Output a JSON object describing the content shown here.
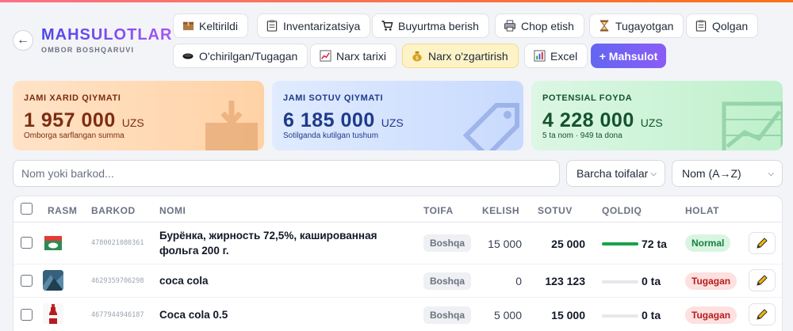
{
  "header": {
    "back_icon": "arrow-left-icon",
    "title": "MAHSULOTLAR",
    "subtitle": "OMBOR BOSHQARUVI"
  },
  "toolbar": {
    "keltirildi": "Keltirildi",
    "inventarizatsiya": "Inventarizatsiya",
    "buyurtma": "Buyurtma berish",
    "chop": "Chop etish",
    "tugayotgan": "Tugayotgan",
    "qolgan": "Qolgan",
    "ochirilgan": "O'chirilgan/Tugagan",
    "narx_tarixi": "Narx tarixi",
    "narx_ozgartirish": "Narx o'zgartirish",
    "excel": "Excel",
    "add": "+ Mahsulot"
  },
  "stats": {
    "purchase": {
      "label": "JAMI XARID QIYMATI",
      "value": "1 957 000",
      "unit": "UZS",
      "note": "Omborga sarflangan summa"
    },
    "sales": {
      "label": "JAMI SOTUV QIYMATI",
      "value": "6 185 000",
      "unit": "UZS",
      "note": "Sotilganda kutilgan tushum"
    },
    "profit": {
      "label": "POTENSIAL FOYDA",
      "value": "4 228 000",
      "unit": "UZS",
      "note": "5 ta nom · 949 ta dona"
    }
  },
  "filters": {
    "search_placeholder": "Nom yoki barkod...",
    "category": "Barcha toifalar",
    "sort": "Nom (A→Z)"
  },
  "table": {
    "headers": [
      "RASM",
      "BARKOD",
      "NOMI",
      "TOIFA",
      "KELISH",
      "SOTUV",
      "QOLDIQ",
      "HOLAT"
    ],
    "rows": [
      {
        "barcode": "4780021080361",
        "name_line1": "Бурёнка, жирность 72,5%, кашированная",
        "name_line2": "фольга 200 г.",
        "category": "Boshqa",
        "kelish": "15 000",
        "sotuv": "25 000",
        "qoldiq": "72 ta",
        "level": 1.0,
        "status": "Normal"
      },
      {
        "barcode": "4629359706298",
        "name": "coca cola",
        "category": "Boshqa",
        "kelish": "0",
        "sotuv": "123 123",
        "qoldiq": "0 ta",
        "level": 0,
        "status": "Tugagan"
      },
      {
        "barcode": "4677944946187",
        "name": "Coca cola 0.5",
        "category": "Boshqa",
        "kelish": "5 000",
        "sotuv": "15 000",
        "qoldiq": "0 ta",
        "level": 0,
        "status": "Tugagan"
      }
    ]
  },
  "colors": {
    "accent": "#6366f1",
    "normal": "#15803d",
    "tugagan": "#b91c1c"
  }
}
